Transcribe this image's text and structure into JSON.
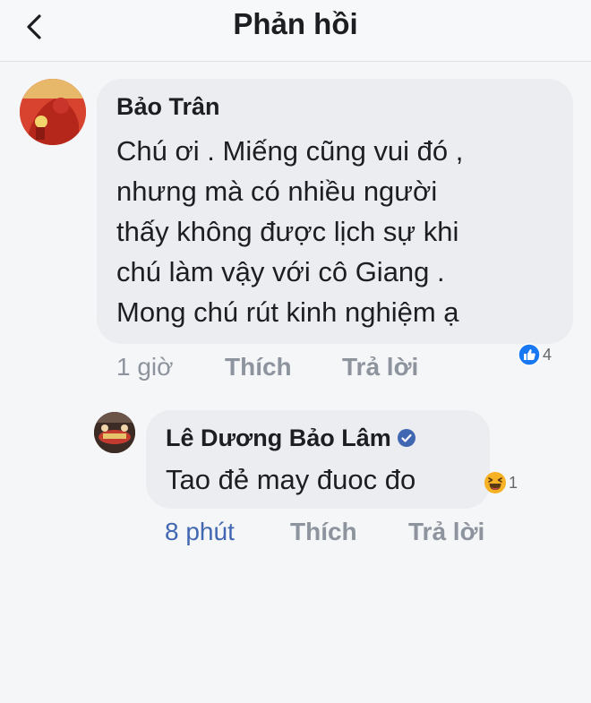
{
  "header": {
    "title": "Phản hồi",
    "back_icon": "chevron-left-icon"
  },
  "comment": {
    "author": "Bảo Trân",
    "lines": [
      "Chú ơi . Miếng cũng vui đó ,",
      "nhưng mà có nhiều người",
      "thấy không được lịch sự khi",
      "chú làm vậy với cô  Giang .",
      "Mong chú rút kinh nghiệm ạ"
    ],
    "reaction": {
      "icon": "like-icon",
      "count": "4"
    },
    "time": "1 giờ",
    "like_label": "Thích",
    "reply_label": "Trả lời"
  },
  "reply": {
    "author": "Lê Dương Bảo Lâm",
    "verified": true,
    "text": "Tao đẻ may đuoc đo",
    "reaction": {
      "icon": "haha-icon",
      "count": "1"
    },
    "time": "8 phút",
    "like_label": "Thích",
    "reply_label": "Trả lời"
  },
  "colors": {
    "like_blue": "#1877f2",
    "time_link_blue": "#4267b2",
    "haha_yellow": "#f7b125"
  }
}
